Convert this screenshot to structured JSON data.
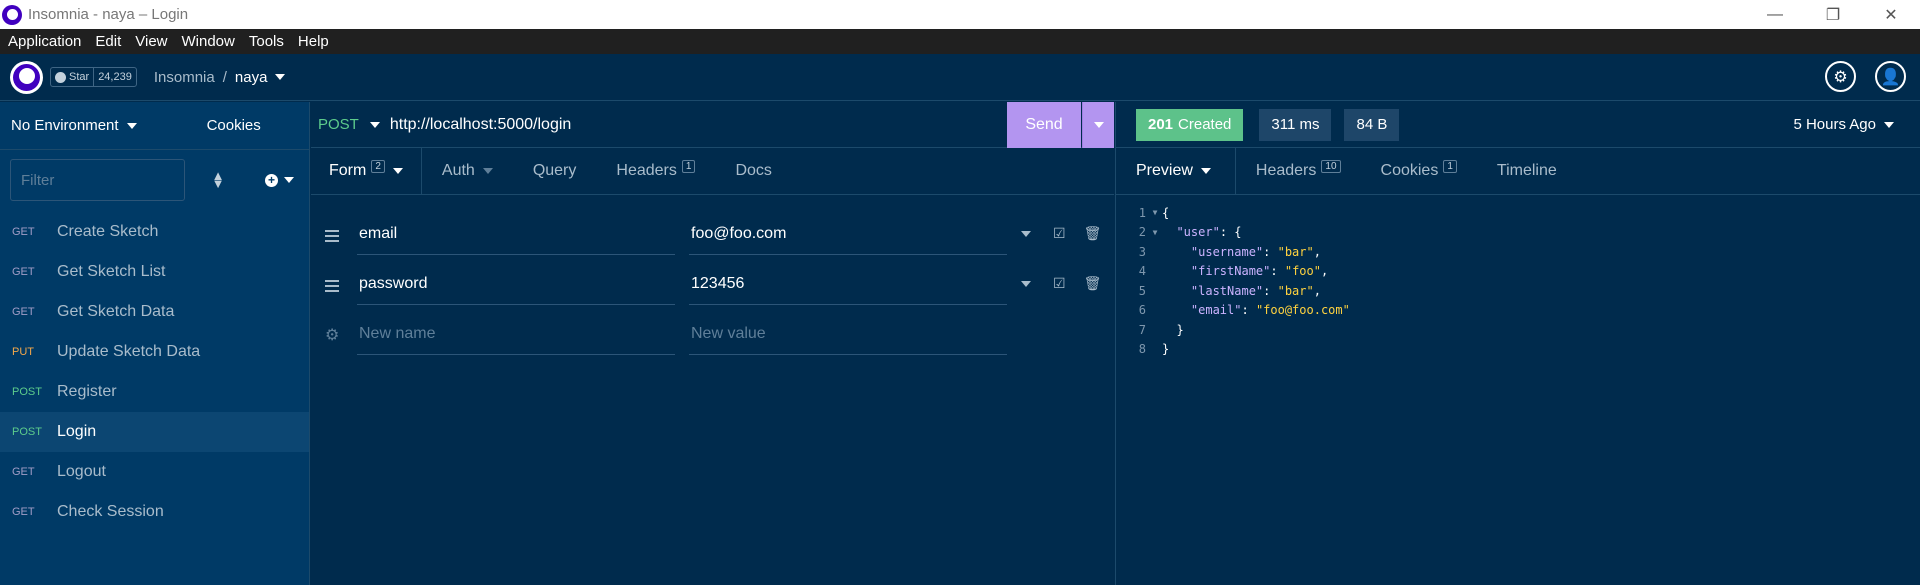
{
  "window": {
    "title": "Insomnia - naya – Login",
    "controls": {
      "minimize": "—",
      "maximize": "❐",
      "close": "✕"
    }
  },
  "menu": [
    "Application",
    "Edit",
    "View",
    "Window",
    "Tools",
    "Help"
  ],
  "header": {
    "github": {
      "star_label": "Star",
      "count": "24,239"
    },
    "breadcrumb": {
      "root": "Insomnia",
      "separator": "/",
      "current": "naya"
    }
  },
  "sidebar": {
    "environment": "No Environment",
    "cookies": "Cookies",
    "filter_placeholder": "Filter",
    "requests": [
      {
        "method": "GET",
        "name": "Create Sketch"
      },
      {
        "method": "GET",
        "name": "Get Sketch List"
      },
      {
        "method": "GET",
        "name": "Get Sketch Data"
      },
      {
        "method": "PUT",
        "name": "Update Sketch Data"
      },
      {
        "method": "POST",
        "name": "Register"
      },
      {
        "method": "POST",
        "name": "Login",
        "active": true
      },
      {
        "method": "GET",
        "name": "Logout"
      },
      {
        "method": "GET",
        "name": "Check Session"
      }
    ]
  },
  "request": {
    "method": "POST",
    "url": "http://localhost:5000/login",
    "send_label": "Send",
    "tabs": [
      {
        "label": "Form",
        "badge": "2"
      },
      {
        "label": "Auth"
      },
      {
        "label": "Query"
      },
      {
        "label": "Headers",
        "badge": "1"
      },
      {
        "label": "Docs"
      }
    ],
    "form": [
      {
        "name": "email",
        "value": "foo@foo.com"
      },
      {
        "name": "password",
        "value": "123456"
      }
    ],
    "new_name_placeholder": "New name",
    "new_value_placeholder": "New value"
  },
  "response": {
    "status_code": "201",
    "status_text": "Created",
    "time": "311 ms",
    "size": "84 B",
    "age": "5 Hours Ago",
    "tabs": [
      {
        "label": "Preview"
      },
      {
        "label": "Headers",
        "badge": "10"
      },
      {
        "label": "Cookies",
        "badge": "1"
      },
      {
        "label": "Timeline"
      }
    ],
    "body_lines": [
      {
        "n": "1",
        "fold": true,
        "indent": "",
        "open": "{"
      },
      {
        "n": "2",
        "fold": true,
        "indent": "  ",
        "key": "\"user\"",
        "after": ": {"
      },
      {
        "n": "3",
        "indent": "    ",
        "key": "\"username\"",
        "mid": ": ",
        "value": "\"bar\"",
        "after": ","
      },
      {
        "n": "4",
        "indent": "    ",
        "key": "\"firstName\"",
        "mid": ": ",
        "value": "\"foo\"",
        "after": ","
      },
      {
        "n": "5",
        "indent": "    ",
        "key": "\"lastName\"",
        "mid": ": ",
        "value": "\"bar\"",
        "after": ","
      },
      {
        "n": "6",
        "indent": "    ",
        "key": "\"email\"",
        "mid": ": ",
        "value": "\"foo@foo.com\"",
        "after": ""
      },
      {
        "n": "7",
        "indent": "  ",
        "open": "}"
      },
      {
        "n": "8",
        "indent": "",
        "open": "}"
      }
    ]
  },
  "colors": {
    "background": "#002b4d",
    "sidebar": "#003a66",
    "send": "#b395f0",
    "status_ok": "#5dc28a",
    "method_get": "#a29dc7",
    "method_put": "#f4a84a",
    "method_post": "#5dcc8c"
  }
}
